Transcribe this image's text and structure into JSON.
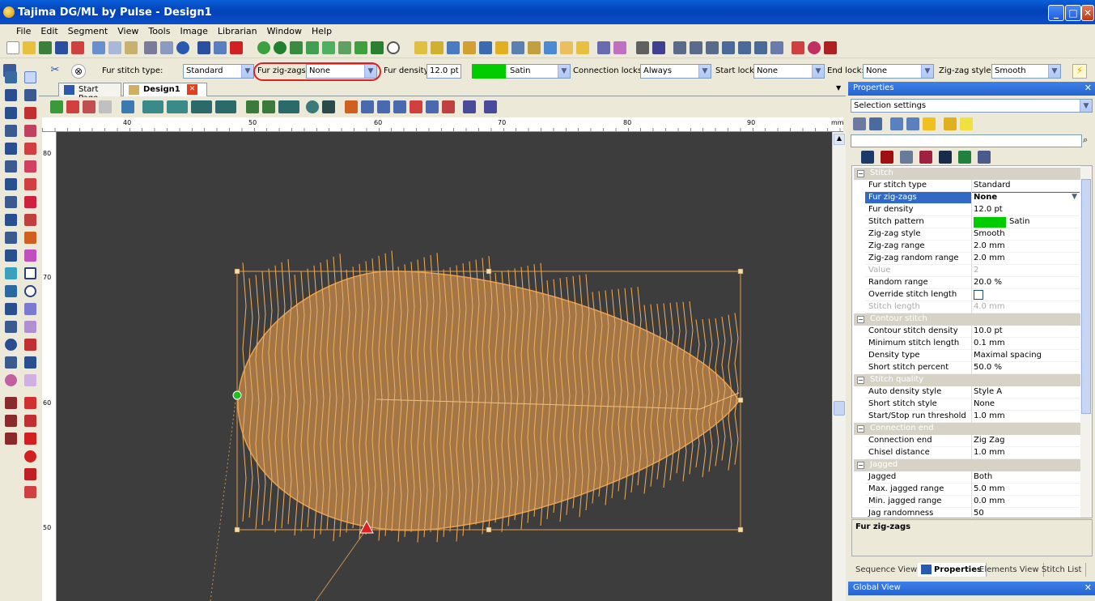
{
  "window": {
    "title": "Tajima DG/ML by Pulse - Design1"
  },
  "menu": [
    "File",
    "Edit",
    "Segment",
    "View",
    "Tools",
    "Image",
    "Librarian",
    "Window",
    "Help"
  ],
  "toolbar2": {
    "fur_stitch_type_label": "Fur stitch type:",
    "fur_stitch_type_value": "Standard",
    "fur_zigzags_label": "Fur zig-zags:",
    "fur_zigzags_value": "None",
    "fur_density_label": "Fur density:",
    "fur_density_value": "12.0 pt",
    "stitch_pattern_value": "Satin",
    "connection_locks_label": "Connection locks:",
    "connection_locks_value": "Always",
    "start_lock_label": "Start lock:",
    "start_lock_value": "None",
    "end_lock_label": "End lock:",
    "end_lock_value": "None",
    "zigzag_style_label": "Zig-zag style:",
    "zigzag_style_value": "Smooth"
  },
  "doc_tabs": {
    "start_page": "Start Page",
    "design": "Design1"
  },
  "ruler": {
    "h_ticks": [
      "40",
      "50",
      "60",
      "70",
      "80",
      "90"
    ],
    "unit": "mm",
    "v_ticks": [
      "80",
      "70",
      "60",
      "50"
    ]
  },
  "properties": {
    "title": "Properties",
    "selection": "Selection settings",
    "categories": {
      "stitch": "Stitch",
      "contour": "Contour stitch",
      "quality": "Stitch quality",
      "connection": "Connection end",
      "jagged": "Jagged"
    },
    "rows": [
      {
        "k": "Fur stitch type",
        "v": "Standard"
      },
      {
        "k": "Fur zig-zags",
        "v": "None"
      },
      {
        "k": "Fur density",
        "v": "12.0 pt"
      },
      {
        "k": "Stitch pattern",
        "v": "Satin"
      },
      {
        "k": "Zig-zag style",
        "v": "Smooth"
      },
      {
        "k": "Zig-zag range",
        "v": "2.0 mm"
      },
      {
        "k": "Zig-zag random range",
        "v": "2.0 mm"
      },
      {
        "k": "Value",
        "v": "2"
      },
      {
        "k": "Random range",
        "v": "20.0 %"
      },
      {
        "k": "Override stitch length",
        "v": ""
      },
      {
        "k": "Stitch length",
        "v": "4.0 mm"
      },
      {
        "k": "Contour stitch density",
        "v": "10.0 pt"
      },
      {
        "k": "Minimum stitch length",
        "v": "0.1 mm"
      },
      {
        "k": "Density type",
        "v": "Maximal spacing"
      },
      {
        "k": "Short stitch percent",
        "v": "50.0 %"
      },
      {
        "k": "Auto density style",
        "v": "Style A"
      },
      {
        "k": "Short stitch style",
        "v": "None"
      },
      {
        "k": "Start/Stop run threshold",
        "v": "1.0 mm"
      },
      {
        "k": "Connection end",
        "v": "Zig Zag"
      },
      {
        "k": "Chisel distance",
        "v": "1.0 mm"
      },
      {
        "k": "Jagged",
        "v": "Both"
      },
      {
        "k": "Max. jagged range",
        "v": "5.0 mm"
      },
      {
        "k": "Min. jagged range",
        "v": "0.0 mm"
      },
      {
        "k": "Jag randomness",
        "v": "50"
      }
    ],
    "description_title": "Fur zig-zags",
    "bottom_tabs": [
      "Sequence View",
      "Properties",
      "Elements View",
      "Stitch List"
    ],
    "global_view": "Global View"
  },
  "colors": {
    "accent": "#316ac5",
    "stitch": "#e8a050",
    "fill": "#c78a4a",
    "canvas": "#3d3d3d",
    "satin_swatch": "#00cc00"
  }
}
